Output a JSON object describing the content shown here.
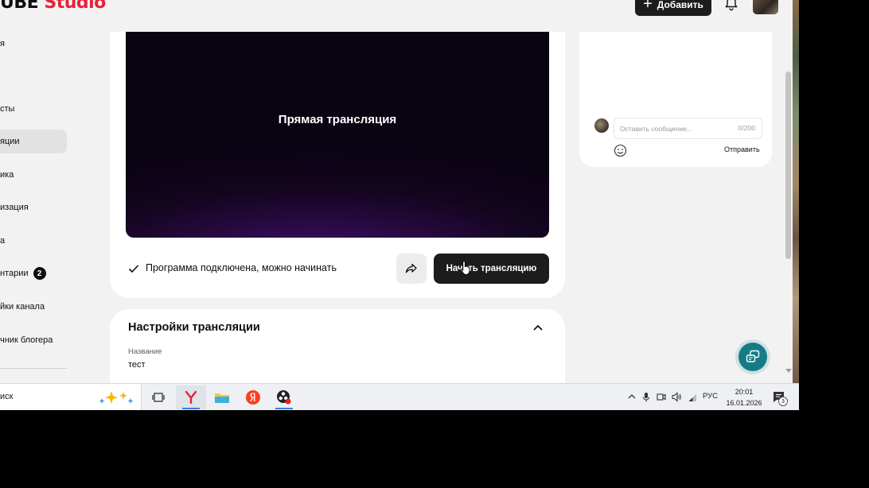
{
  "header": {
    "logo_left": "UBE",
    "logo_right": "Studio",
    "add_button_label": "Добавить"
  },
  "sidebar": {
    "items": [
      {
        "label": "я"
      },
      {
        "label": "сты"
      },
      {
        "label": "яции"
      },
      {
        "label": "ика"
      },
      {
        "label": "изация"
      },
      {
        "label": "а"
      },
      {
        "label": "нтарии",
        "badge": "2"
      },
      {
        "label": "йки канала"
      },
      {
        "label": "чник блогера"
      }
    ]
  },
  "stream": {
    "preview_title": "Прямая трансляция",
    "status_text": "Программа подключена, можно начинать",
    "start_button_label": "Начать трансляцию"
  },
  "settings": {
    "title": "Настройки трансляции",
    "name_label": "Название",
    "name_value": "тест"
  },
  "chat": {
    "input_placeholder": "Оставить сообщение...",
    "counter": "0/200",
    "send_label": "Отправить"
  },
  "taskbar": {
    "search_text": "иск",
    "language": "РУС",
    "time": "20:01",
    "date": "16.01.2026",
    "notification_count": "3",
    "apps": [
      "task-view-icon",
      "yandex-browser-icon",
      "file-explorer-icon",
      "yandex-icon",
      "obs-icon"
    ]
  },
  "colors": {
    "accent_red": "#e8213a",
    "button_dark": "#1c1c1e",
    "help_fab": "#147c87",
    "preview_purple": "#4a1370"
  }
}
